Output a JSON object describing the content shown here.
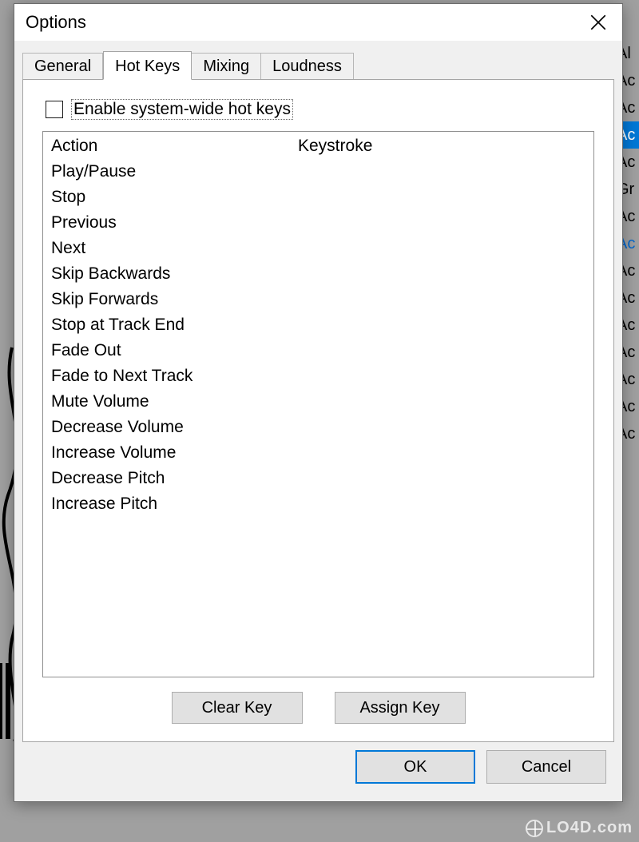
{
  "window": {
    "title": "Options"
  },
  "tabs": {
    "general": "General",
    "hotkeys": "Hot Keys",
    "mixing": "Mixing",
    "loudness": "Loudness"
  },
  "hotkeys_page": {
    "enable_label": "Enable system-wide hot keys",
    "columns": {
      "action": "Action",
      "keystroke": "Keystroke"
    },
    "actions": [
      "Play/Pause",
      "Stop",
      "Previous",
      "Next",
      "Skip Backwards",
      "Skip Forwards",
      "Stop at Track End",
      "Fade Out",
      "Fade to Next Track",
      "Mute Volume",
      "Decrease Volume",
      "Increase Volume",
      "Decrease Pitch",
      "Increase Pitch"
    ],
    "clear_key_label": "Clear Key",
    "assign_key_label": "Assign Key"
  },
  "dialog_buttons": {
    "ok": "OK",
    "cancel": "Cancel"
  },
  "background_list": {
    "items": [
      {
        "t": "Al",
        "cls": ""
      },
      {
        "t": "Ac",
        "cls": ""
      },
      {
        "t": "Ac",
        "cls": ""
      },
      {
        "t": "Ac",
        "cls": "sel"
      },
      {
        "t": "Ac",
        "cls": ""
      },
      {
        "t": "Gr",
        "cls": ""
      },
      {
        "t": "Ac",
        "cls": ""
      },
      {
        "t": "Ac",
        "cls": "link"
      },
      {
        "t": "Ac",
        "cls": ""
      },
      {
        "t": "Ac",
        "cls": ""
      },
      {
        "t": "Ac",
        "cls": ""
      },
      {
        "t": "Ac",
        "cls": ""
      },
      {
        "t": "Ac",
        "cls": ""
      },
      {
        "t": "Ac",
        "cls": ""
      },
      {
        "t": "Ac",
        "cls": ""
      }
    ]
  },
  "watermark": "LO4D.com"
}
